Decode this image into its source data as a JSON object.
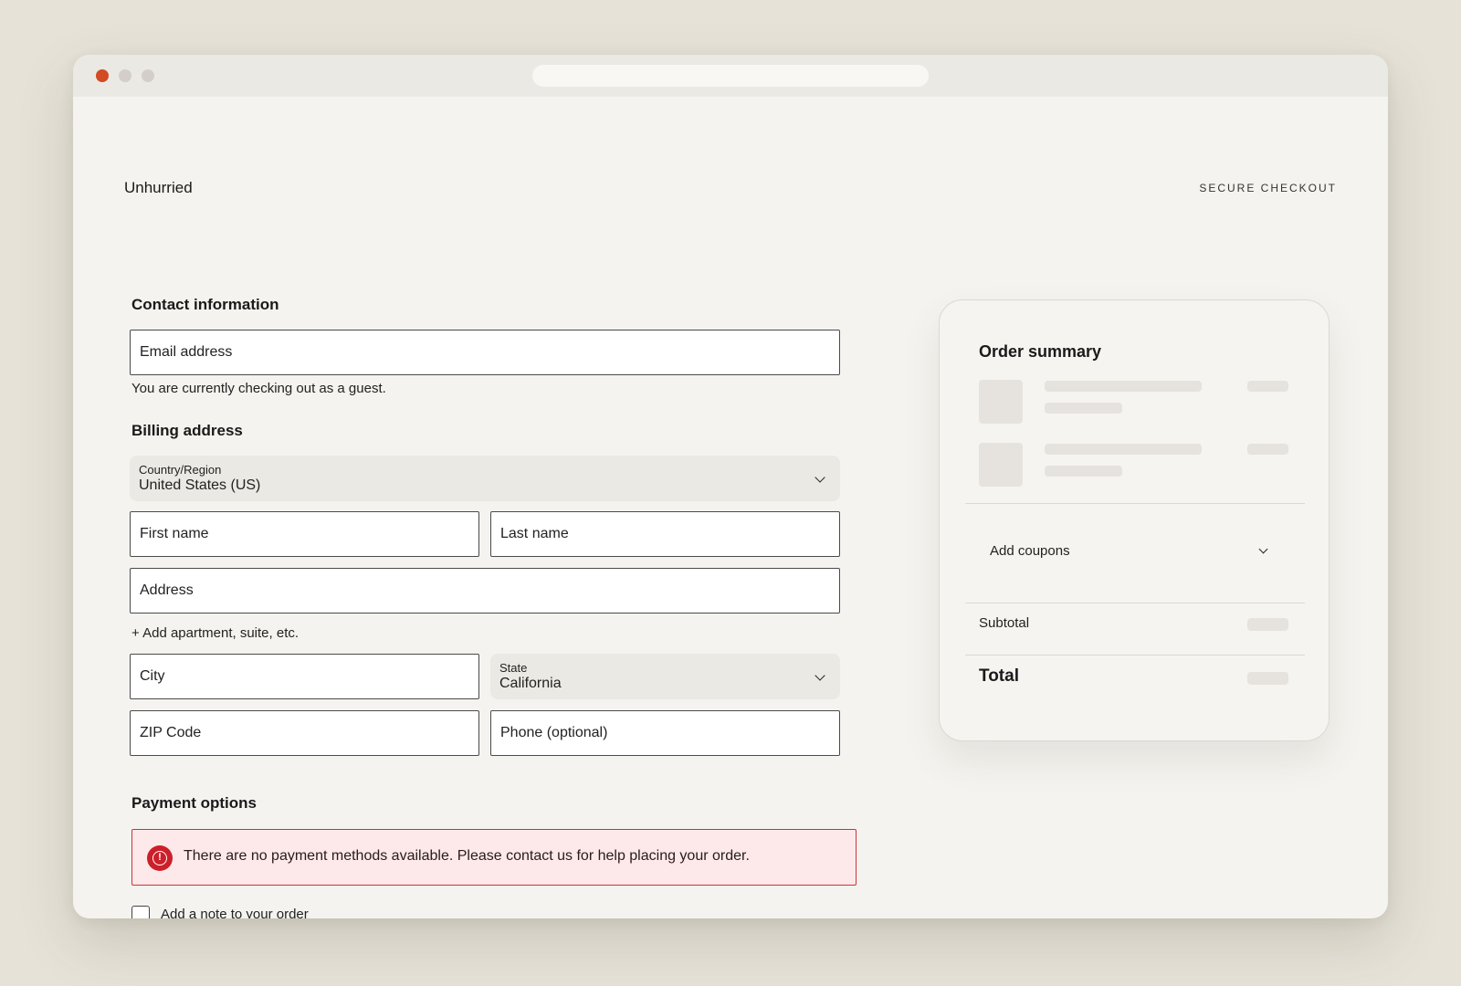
{
  "window": {
    "brand": "Unhurried",
    "secure_label": "SECURE CHECKOUT"
  },
  "contact": {
    "title": "Contact information",
    "email_placeholder": "Email address",
    "guest_note": "You are currently checking out as a guest."
  },
  "billing": {
    "title": "Billing address",
    "country_label": "Country/Region",
    "country_value": "United States (US)",
    "first_name_placeholder": "First name",
    "last_name_placeholder": "Last name",
    "address_placeholder": "Address",
    "add_apartment": "+ Add apartment, suite, etc.",
    "city_placeholder": "City",
    "state_label": "State",
    "state_value": "California",
    "zip_placeholder": "ZIP Code",
    "phone_placeholder": "Phone (optional)"
  },
  "payment": {
    "title": "Payment options",
    "error_message": "There are no payment methods available. Please contact us for help placing your order.",
    "error_icon": "alert-circle-icon"
  },
  "order_note": {
    "label": "Add a note to your order",
    "checked": false
  },
  "summary": {
    "title": "Order summary",
    "coupons_label": "Add coupons",
    "subtotal_label": "Subtotal",
    "total_label": "Total"
  },
  "colors": {
    "accent_red": "#d24b22",
    "error_red": "#cc1f2a",
    "error_bg": "#fde9e9",
    "page_bg": "#e6e2d8",
    "window_bg": "#f5f3ef"
  }
}
